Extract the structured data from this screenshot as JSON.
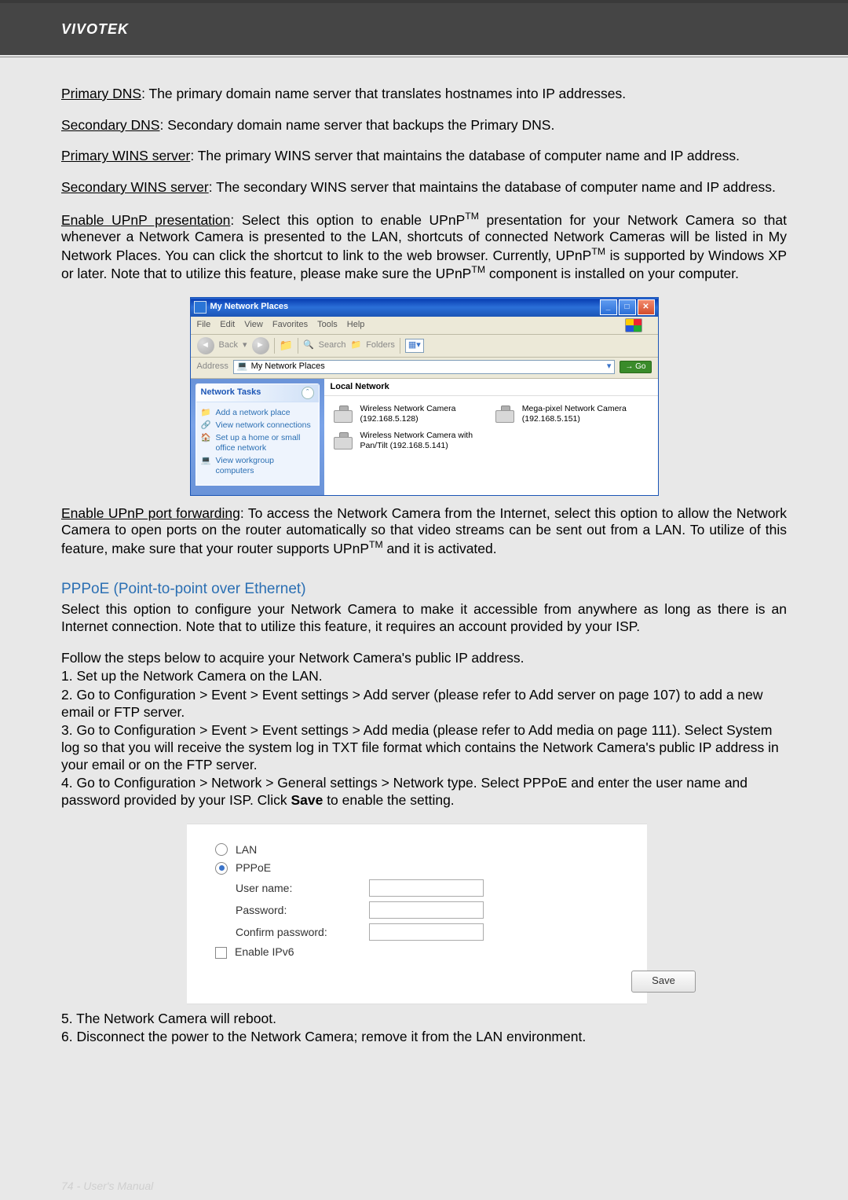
{
  "header": {
    "brand": "VIVOTEK"
  },
  "defs": {
    "primary_dns_label": "Primary DNS",
    "primary_dns_text": ": The primary domain name server that translates hostnames into IP addresses.",
    "secondary_dns_label": "Secondary DNS",
    "secondary_dns_text": ": Secondary domain name server that backups the Primary DNS.",
    "primary_wins_label": "Primary WINS server",
    "primary_wins_text": ": The primary WINS server that maintains the database of computer name and IP address.",
    "secondary_wins_label": "Secondary WINS server",
    "secondary_wins_text": ": The secondary WINS server that maintains the database of computer name and IP address.",
    "upnp_present_label": "Enable UPnP presentation",
    "upnp_present_text_pre": ": Select this option to enable UPnP",
    "upnp_present_text_post": " presentation for your Network Camera so that whenever a Network Camera is presented to the LAN, shortcuts of connected Network Cameras will be listed in My Network Places. You can click the shortcut to link to the web browser. Currently, UPnP",
    "upnp_present_text_tail": " is supported by Windows XP or later. Note that to utilize this feature, please make sure the UPnP",
    "upnp_present_text_end": " component is installed on your computer.",
    "upnp_fwd_label": "Enable UPnP port forwarding",
    "upnp_fwd_text_pre": ": To access the Network Camera from the Internet, select this option to allow the Network Camera to open ports on the router automatically so that video streams can be sent out from a LAN. To utilize of this feature, make sure that your router supports UPnP",
    "upnp_fwd_text_post": " and it is activated."
  },
  "xp": {
    "title": "My Network Places",
    "menu": [
      "File",
      "Edit",
      "View",
      "Favorites",
      "Tools",
      "Help"
    ],
    "toolbar": {
      "back": "Back",
      "search": "Search",
      "folders": "Folders"
    },
    "address_label": "Address",
    "address_value": "My Network Places",
    "go": "Go",
    "tasks_title": "Network Tasks",
    "tasks": [
      "Add a network place",
      "View network connections",
      "Set up a home or small office network",
      "View workgroup computers"
    ],
    "main_group": "Local Network",
    "items": [
      {
        "name": "Wireless Network Camera",
        "sub": "(192.168.5.128)"
      },
      {
        "name": "Mega-pixel Network Camera (192.168.5.151)",
        "sub": ""
      },
      {
        "name": "Wireless Network Camera with Pan/Tilt (192.168.5.141)",
        "sub": ""
      }
    ]
  },
  "pppoe": {
    "section_title": "PPPoE (Point-to-point over Ethernet)",
    "intro": "Select this option to configure your Network Camera to make it accessible from anywhere as long as there is an Internet connection. Note that to utilize this feature, it requires an account provided by your ISP.",
    "follow": "Follow the steps below to acquire your Network Camera's public IP address.",
    "steps": [
      "1. Set up the Network Camera on the LAN.",
      "2. Go to Configuration > Event > Event settings > Add server (please refer to Add server on page 107) to add a new email or FTP server.",
      "3. Go to Configuration > Event > Event settings > Add media (please refer to Add media on page 111). Select System log so that you will receive the system log in TXT file format which contains the Network Camera's public IP address in your email or on the FTP server.",
      "4. Go to Configuration > Network > General settings > Network type. Select PPPoE and enter the user name and password provided by your ISP. Click "
    ],
    "save_inline": "Save",
    "step4_tail": " to enable the setting.",
    "form": {
      "lan": "LAN",
      "pppoe": "PPPoE",
      "user": "User name:",
      "pass": "Password:",
      "confirm": "Confirm password:",
      "ipv6": "Enable IPv6",
      "save": "Save"
    },
    "steps_after": [
      "5. The Network Camera will reboot.",
      "6. Disconnect the power to the Network Camera; remove it from the LAN environment."
    ]
  },
  "tm": "TM",
  "footer": {
    "page": "74",
    "sep": " - ",
    "title": "User's Manual"
  }
}
